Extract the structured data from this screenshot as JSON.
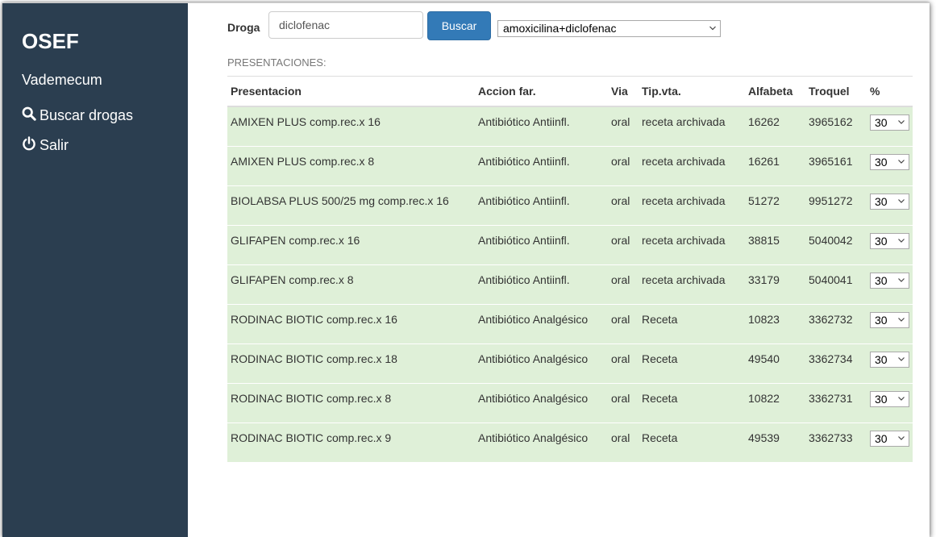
{
  "sidebar": {
    "brand": "OSEF",
    "subtitle": "Vademecum",
    "nav": [
      {
        "label": "Buscar drogas",
        "icon": "search-icon"
      },
      {
        "label": "Salir",
        "icon": "power-icon"
      }
    ],
    "background": "#2b3e50"
  },
  "search": {
    "label": "Droga",
    "input_value": "diclofenac",
    "button_label": "Buscar",
    "select_value": "amoxicilina+diclofenac"
  },
  "section_title": "PRESENTACIONES:",
  "table": {
    "headers": [
      "Presentacion",
      "Accion far.",
      "Via",
      "Tip.vta.",
      "Alfabeta",
      "Troquel",
      "%"
    ],
    "rows": [
      {
        "presentacion": "AMIXEN PLUS comp.rec.x 16",
        "accion": "Antibiótico Antiinfl.",
        "via": "oral",
        "tipvta": "receta archivada",
        "alfabeta": "16262",
        "troquel": "3965162",
        "pct": "30"
      },
      {
        "presentacion": "AMIXEN PLUS comp.rec.x 8",
        "accion": "Antibiótico Antiinfl.",
        "via": "oral",
        "tipvta": "receta archivada",
        "alfabeta": "16261",
        "troquel": "3965161",
        "pct": "30"
      },
      {
        "presentacion": "BIOLABSA PLUS 500/25 mg comp.rec.x 16",
        "accion": "Antibiótico Antiinfl.",
        "via": "oral",
        "tipvta": "receta archivada",
        "alfabeta": "51272",
        "troquel": "9951272",
        "pct": "30"
      },
      {
        "presentacion": "GLIFAPEN comp.rec.x 16",
        "accion": "Antibiótico Antiinfl.",
        "via": "oral",
        "tipvta": "receta archivada",
        "alfabeta": "38815",
        "troquel": "5040042",
        "pct": "30"
      },
      {
        "presentacion": "GLIFAPEN comp.rec.x 8",
        "accion": "Antibiótico Antiinfl.",
        "via": "oral",
        "tipvta": "receta archivada",
        "alfabeta": "33179",
        "troquel": "5040041",
        "pct": "30"
      },
      {
        "presentacion": "RODINAC BIOTIC comp.rec.x 16",
        "accion": "Antibiótico Analgésico",
        "via": "oral",
        "tipvta": "Receta",
        "alfabeta": "10823",
        "troquel": "3362732",
        "pct": "30"
      },
      {
        "presentacion": "RODINAC BIOTIC comp.rec.x 18",
        "accion": "Antibiótico Analgésico",
        "via": "oral",
        "tipvta": "Receta",
        "alfabeta": "49540",
        "troquel": "3362734",
        "pct": "30"
      },
      {
        "presentacion": "RODINAC BIOTIC comp.rec.x 8",
        "accion": "Antibiótico Analgésico",
        "via": "oral",
        "tipvta": "Receta",
        "alfabeta": "10822",
        "troquel": "3362731",
        "pct": "30"
      },
      {
        "presentacion": "RODINAC BIOTIC comp.rec.x 9",
        "accion": "Antibiótico Analgésico",
        "via": "oral",
        "tipvta": "Receta",
        "alfabeta": "49539",
        "troquel": "3362733",
        "pct": "30"
      }
    ],
    "row_color": "#dff0d8"
  },
  "colors": {
    "button": "#337ab7"
  }
}
